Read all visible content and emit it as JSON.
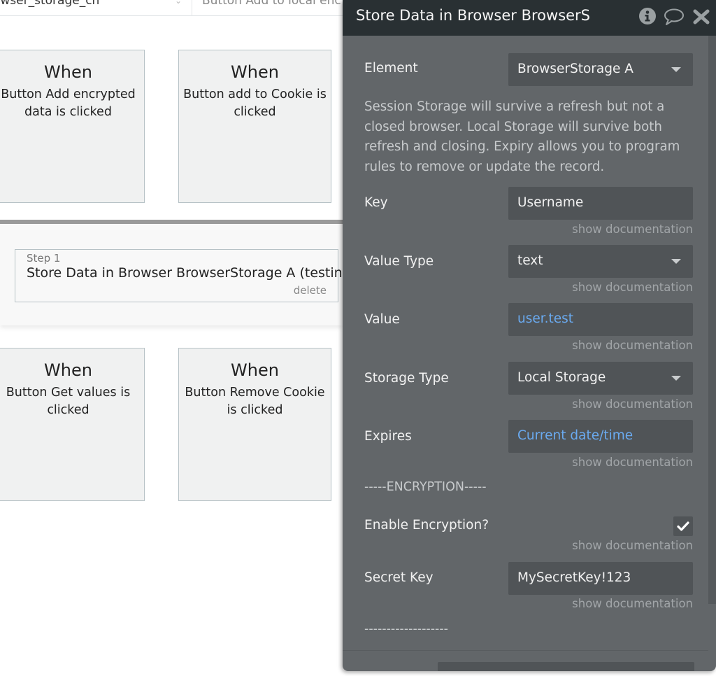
{
  "canvas": {
    "topbar": {
      "cell1_text": "owser_storage_ch",
      "cell2_text": "Button Add to local enc"
    },
    "event_cards": [
      {
        "when": "When",
        "description": "Button Add encrypted data is clicked"
      },
      {
        "when": "When",
        "description": "Button add to Cookie is clicked"
      },
      {
        "when": "When",
        "description": "Button Get values is clicked"
      },
      {
        "when": "When",
        "description": "Button Remove Cookie is clicked"
      }
    ],
    "step": {
      "label": "Step 1",
      "title": "Store Data in Browser BrowserStorage A (testing)",
      "delete_label": "delete"
    }
  },
  "panel": {
    "title": "Store Data in Browser BrowserS",
    "icons": {
      "info": "info-icon",
      "comment": "comment-icon",
      "close": "close-icon"
    },
    "element": {
      "label": "Element",
      "value": "BrowserStorage A"
    },
    "help_text": "Session Storage will survive a refresh but not a closed browser. Local Storage will survive both refresh and closing. Expiry allows you to program rules to remove or update the record.",
    "fields": {
      "key": {
        "label": "Key",
        "value": "Username"
      },
      "value_type": {
        "label": "Value Type",
        "value": "text"
      },
      "value": {
        "label": "Value",
        "value": "user.test"
      },
      "storage_type": {
        "label": "Storage Type",
        "value": "Local Storage"
      },
      "expires": {
        "label": "Expires",
        "value": "Current date/time"
      },
      "enable_encryption": {
        "label": "Enable Encryption?",
        "checked": true
      },
      "secret_key": {
        "label": "Secret Key",
        "value": "MySecretKey!123"
      }
    },
    "doc_link": "show documentation",
    "encryption_divider": "-----ENCRYPTION-----",
    "end_divider": "-------------------",
    "colors": {
      "header_bg": "#293033",
      "panel_bg": "#626669",
      "field_bg": "#505457",
      "dynamic_value": "#6aaaf0"
    }
  }
}
